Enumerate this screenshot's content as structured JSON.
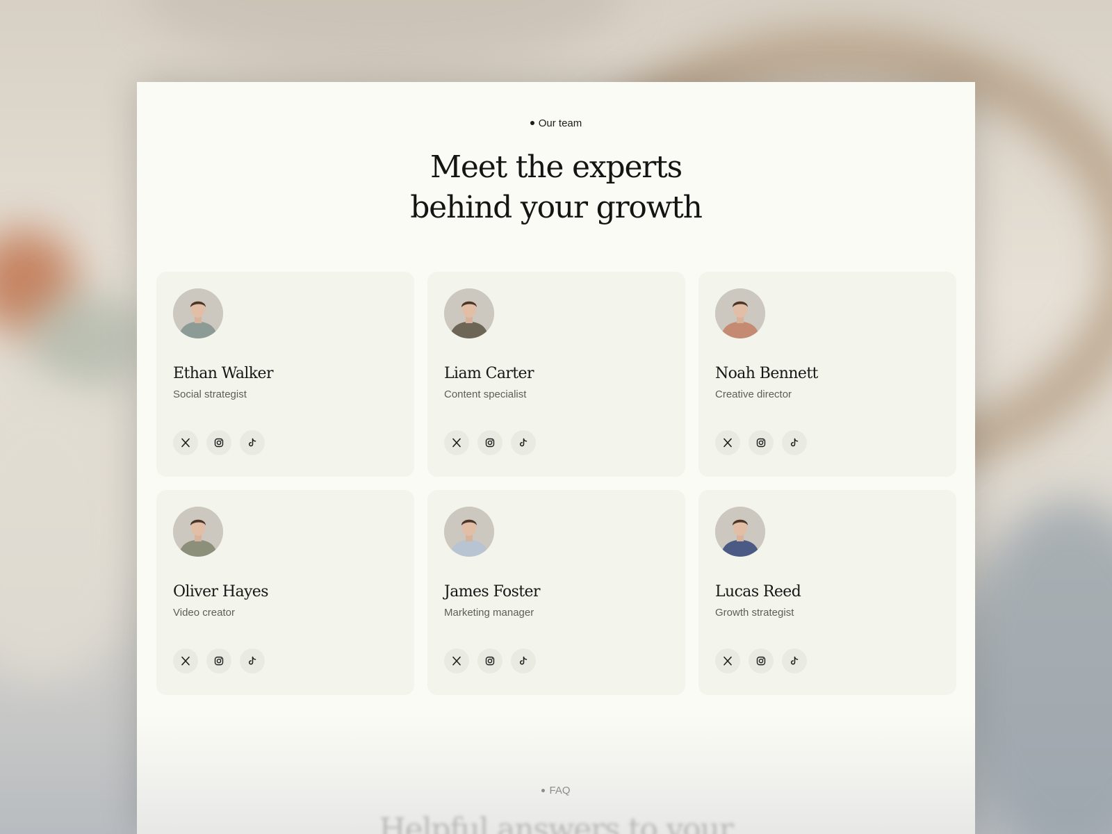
{
  "team": {
    "eyebrow": "Our team",
    "headline_line1": "Meet the experts",
    "headline_line2": "behind your growth",
    "members": [
      {
        "name": "Ethan Walker",
        "role": "Social strategist"
      },
      {
        "name": "Liam Carter",
        "role": "Content specialist"
      },
      {
        "name": "Noah Bennett",
        "role": "Creative director"
      },
      {
        "name": "Oliver Hayes",
        "role": "Video creator"
      },
      {
        "name": "James Foster",
        "role": "Marketing manager"
      },
      {
        "name": "Lucas Reed",
        "role": "Growth strategist"
      }
    ],
    "social_icons": [
      "x-icon",
      "instagram-icon",
      "tiktok-icon"
    ]
  },
  "faq": {
    "eyebrow": "FAQ",
    "heading_partial": "Helpful answers to your"
  },
  "colors": {
    "page_bg": "#fbfbf5",
    "card_bg": "#f3f4ec",
    "text": "#141413",
    "muted": "#5e5e58",
    "shirt_colors": [
      "#8d9b96",
      "#6d6656",
      "#c58a72",
      "#8c8f7a",
      "#b9c4d2",
      "#4b5a84"
    ]
  }
}
